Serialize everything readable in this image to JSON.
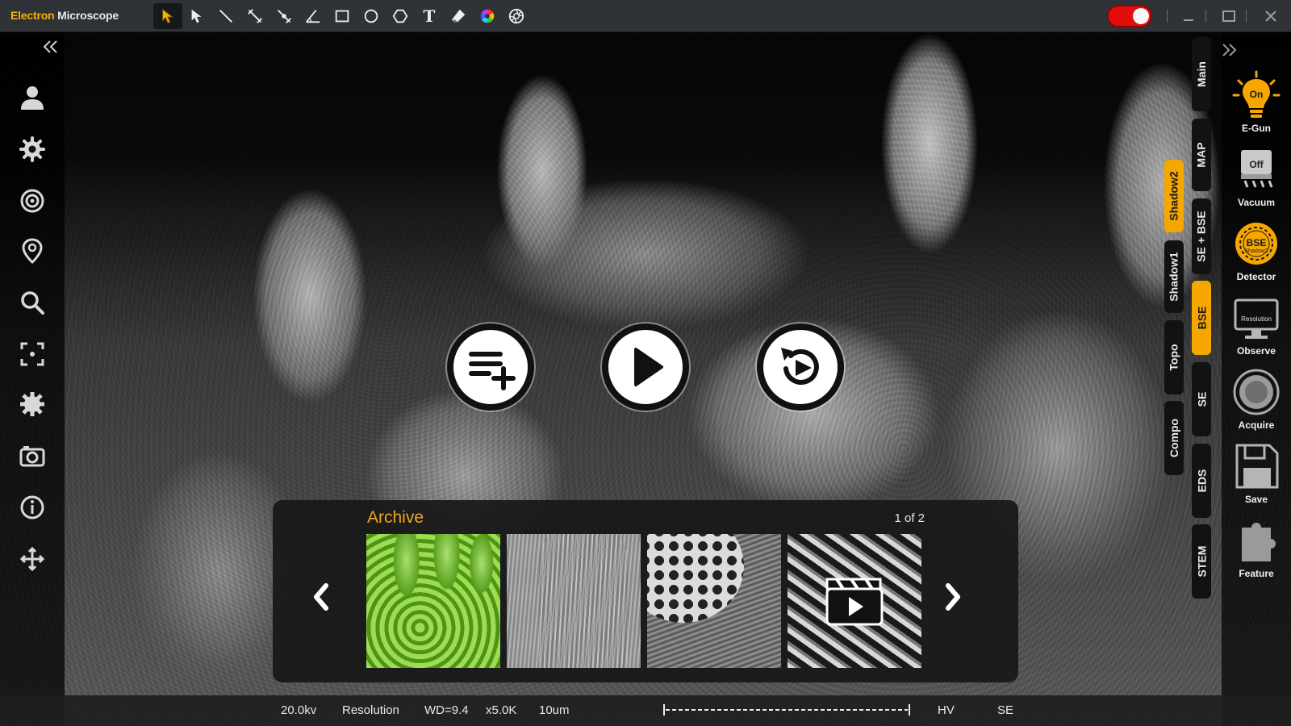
{
  "app": {
    "title_part1": "Electron",
    "title_part2": "Microscope"
  },
  "toolbar": {
    "tools": [
      "select-arrow-icon",
      "pointer-icon",
      "line-icon",
      "measure-line-icon",
      "measure-point-icon",
      "angle-icon",
      "rectangle-icon",
      "circle-icon",
      "polygon-icon",
      "text-icon",
      "eraser-icon",
      "color-wheel-icon",
      "aperture-icon"
    ],
    "text_tool_label": "T",
    "power_state": "on"
  },
  "left_tools": [
    "user-icon",
    "settings-gear-icon",
    "target-icon",
    "location-pin-icon",
    "search-icon",
    "focus-frame-icon",
    "sun-brightness-icon",
    "camera-icon",
    "info-icon",
    "move-icon"
  ],
  "center_controls": [
    "add-playlist-icon",
    "play-icon",
    "replay-icon"
  ],
  "archive": {
    "title": "Archive",
    "page": "1 of 2",
    "thumbnails": [
      {
        "kind": "image",
        "tint": "green"
      },
      {
        "kind": "image",
        "tint": "grey"
      },
      {
        "kind": "image",
        "tint": "grey"
      },
      {
        "kind": "video",
        "tint": "grey"
      }
    ]
  },
  "mode_tabs": {
    "outer": [
      "Main",
      "MAP",
      "SE + BSE",
      "BSE",
      "SE",
      "EDS",
      "STEM"
    ],
    "inner": [
      "Shadow2",
      "Shadow1",
      "Topo",
      "Compo"
    ],
    "active_outer": "BSE",
    "active_inner": "Shadow2"
  },
  "controls": {
    "egun": {
      "label": "E-Gun",
      "state": "On"
    },
    "vacuum": {
      "label": "Vacuum",
      "state": "Off"
    },
    "detector": {
      "label": "Detector",
      "mode": "BSE",
      "sub": "Shadow2"
    },
    "observe": {
      "label": "Observe",
      "mode": "Resolution"
    },
    "acquire": {
      "label": "Acquire"
    },
    "save": {
      "label": "Save"
    },
    "feature": {
      "label": "Feature"
    }
  },
  "status": {
    "voltage": "20.0kv",
    "mode": "Resolution",
    "wd": "WD=9.4",
    "magnification": "x5.0K",
    "scale": "10um",
    "hv": "HV",
    "detector": "SE"
  },
  "colors": {
    "accent": "#f5a700",
    "power": "#e30d0d",
    "panel": "#2f3236"
  }
}
